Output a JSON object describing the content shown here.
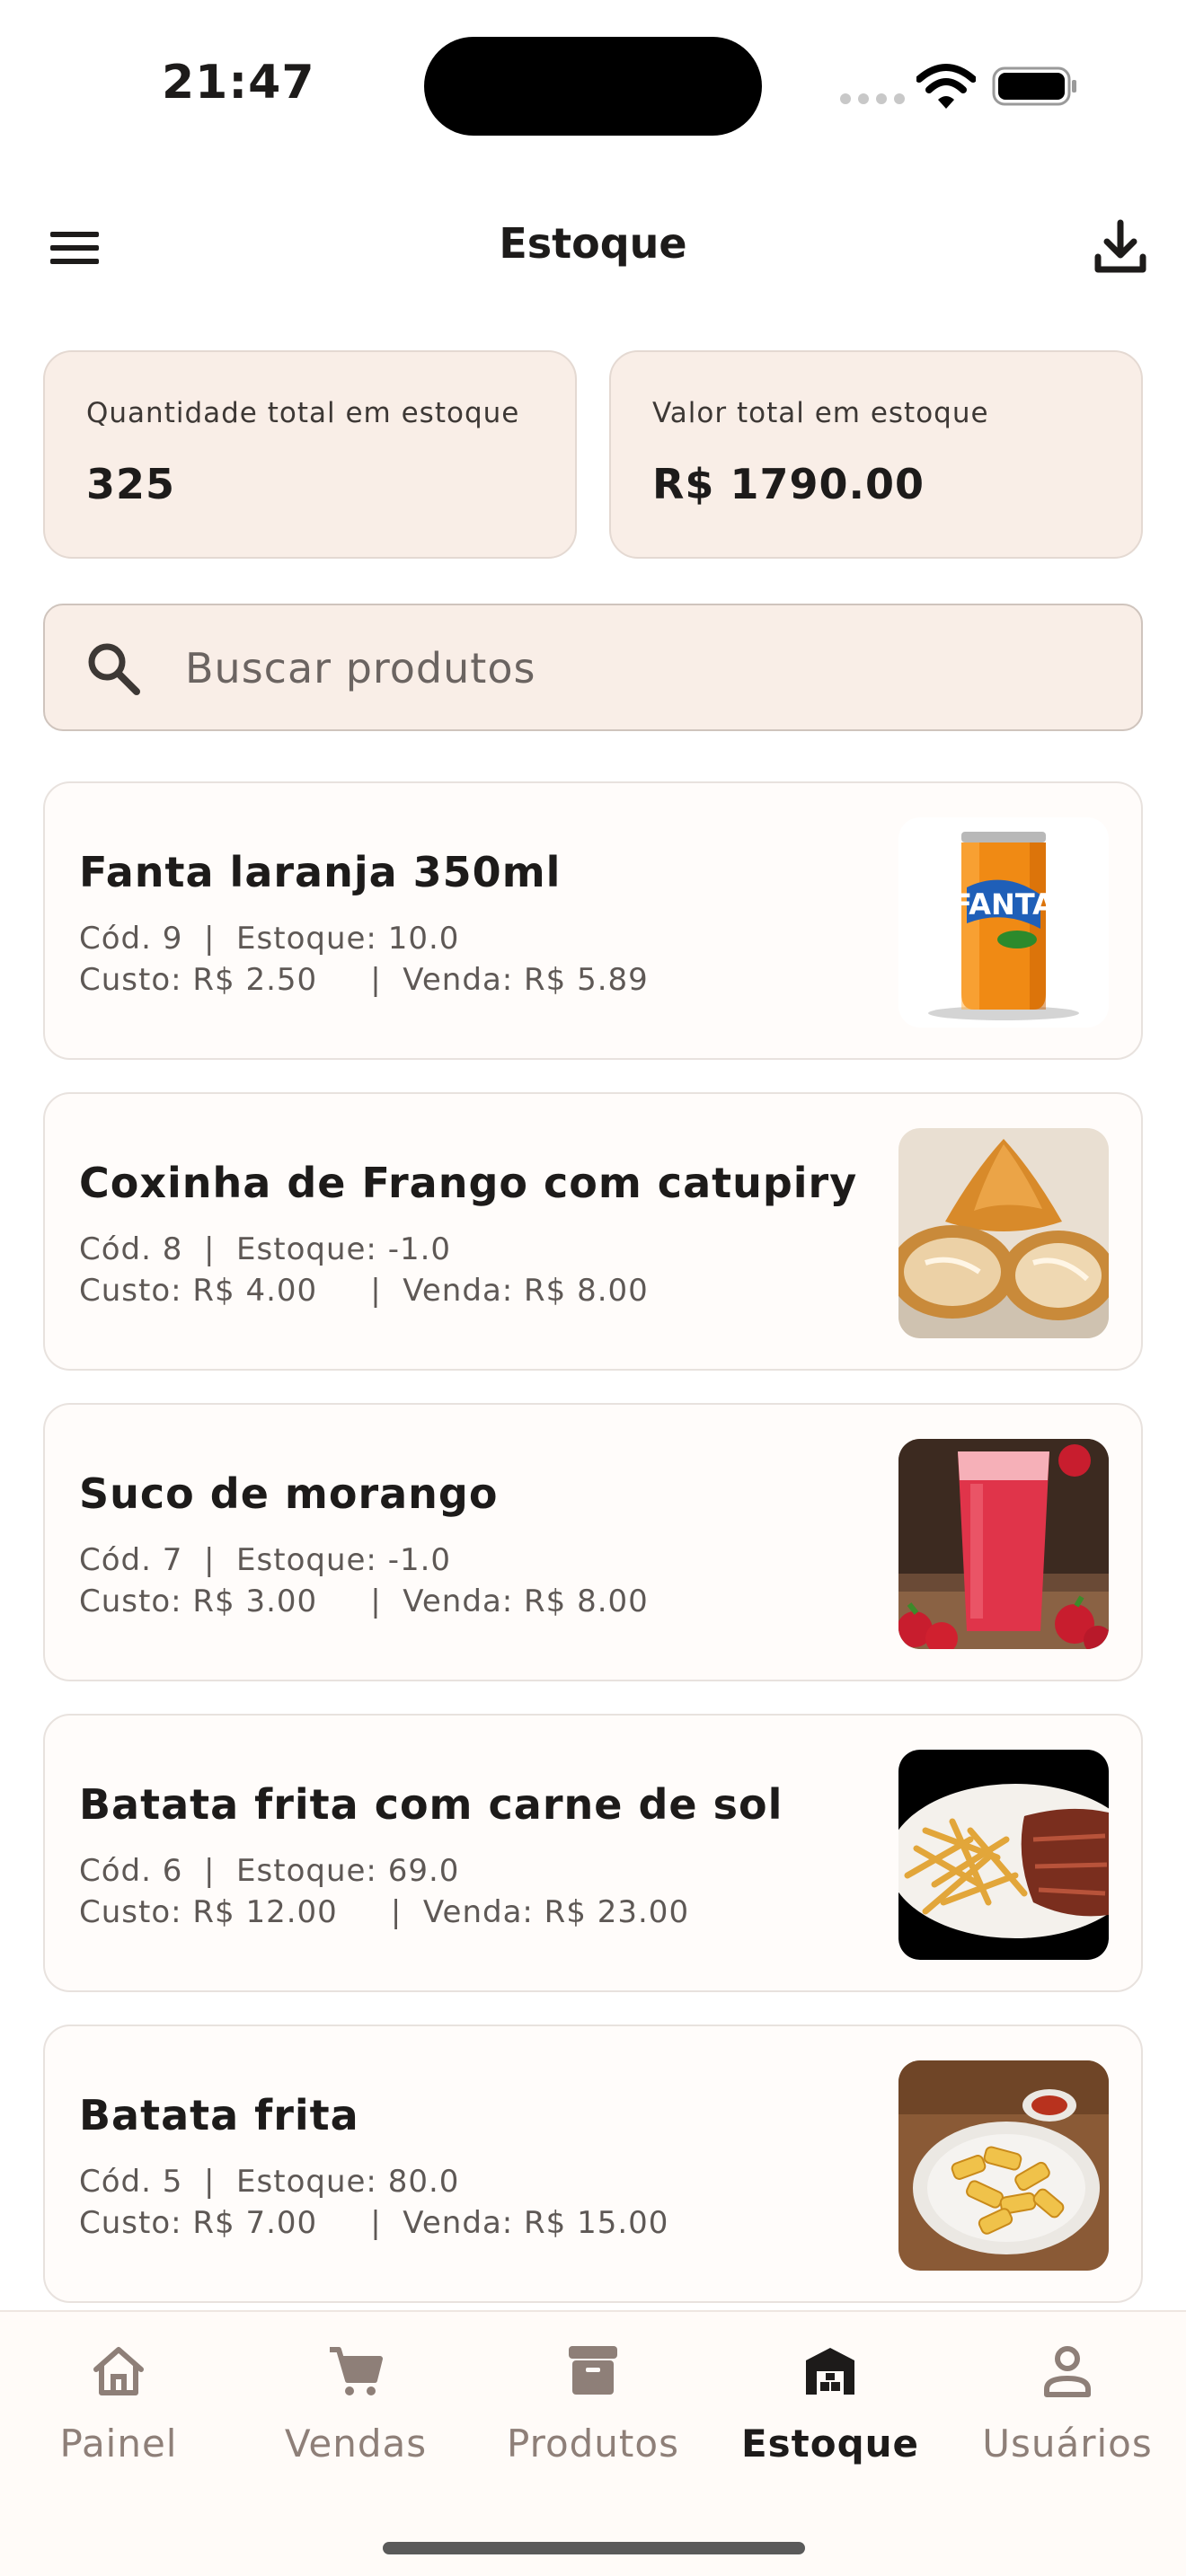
{
  "status_bar": {
    "time": "21:47"
  },
  "app_bar": {
    "title": "Estoque"
  },
  "summary": {
    "quantity_label": "Quantidade total em estoque",
    "quantity_value": "325",
    "value_label": "Valor total em estoque",
    "value_value": "R$ 1790.00"
  },
  "search": {
    "placeholder": "Buscar produtos",
    "value": ""
  },
  "products": [
    {
      "name": "Fanta laranja 350ml",
      "line1": "Cód. 9  |  Estoque: 10.0",
      "line2": "Custo: R$ 2.50     |  Venda: R$ 5.89",
      "image": "orange-soda-can"
    },
    {
      "name": "Coxinha de Frango com catupiry",
      "line1": "Cód. 8  |  Estoque: -1.0",
      "line2": "Custo: R$ 4.00     |  Venda: R$ 8.00",
      "image": "coxinha-photo"
    },
    {
      "name": "Suco de morango",
      "line1": "Cód. 7  |  Estoque: -1.0",
      "line2": "Custo: R$ 3.00     |  Venda: R$ 8.00",
      "image": "strawberry-juice-photo"
    },
    {
      "name": "Batata frita com carne de sol",
      "line1": "Cód. 6  |  Estoque: 69.0",
      "line2": "Custo: R$ 12.00     |  Venda: R$ 23.00",
      "image": "fries-and-beef-photo"
    },
    {
      "name": "Batata frita",
      "line1": "Cód. 5  |  Estoque: 80.0",
      "line2": "Custo: R$ 7.00     |  Venda: R$ 15.00",
      "image": "fries-photo"
    }
  ],
  "nav": [
    {
      "label": "Painel",
      "icon": "home-icon",
      "active": false
    },
    {
      "label": "Vendas",
      "icon": "cart-icon",
      "active": false
    },
    {
      "label": "Produtos",
      "icon": "archive-icon",
      "active": false
    },
    {
      "label": "Estoque",
      "icon": "warehouse-icon",
      "active": true
    },
    {
      "label": "Usuários",
      "icon": "person-icon",
      "active": false
    }
  ],
  "colors": {
    "card_background": "#f9eee7",
    "text_primary": "#1d1b1a",
    "nav_inactive": "#8e7f78"
  }
}
